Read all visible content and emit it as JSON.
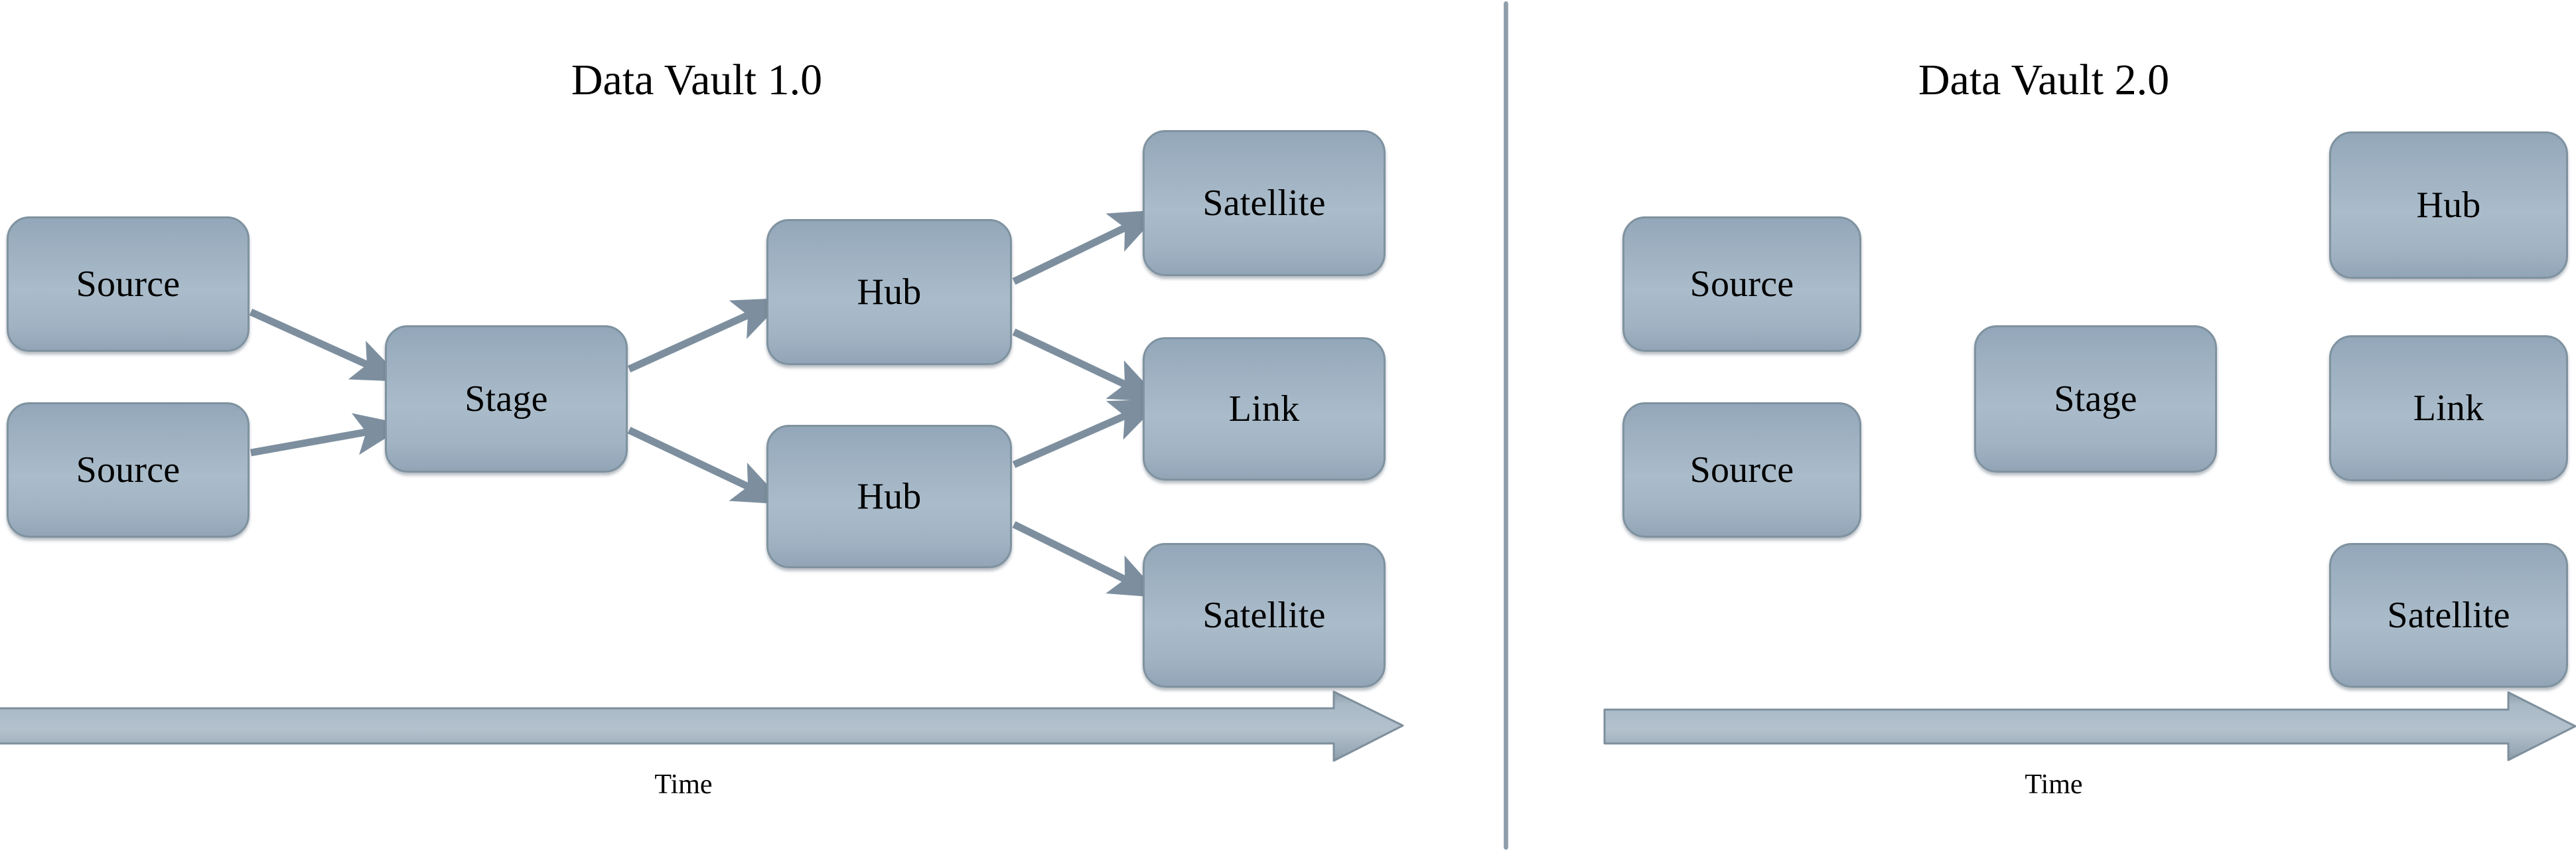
{
  "diagram": {
    "title_left": "Data Vault 1.0",
    "title_right": "Data Vault 2.0",
    "time_label_left": "Time",
    "time_label_right": "Time",
    "colors": {
      "node_fill_top": "#93a7ba",
      "node_fill_mid": "#aabcca",
      "node_border": "#7f929f",
      "connector": "#7d8f9f",
      "divider": "#8b99a7",
      "text": "#000000",
      "background": "#ffffff"
    }
  },
  "left_panel": {
    "title": "Data Vault 1.0",
    "nodes": [
      {
        "id": "l-source-1",
        "label": "Source"
      },
      {
        "id": "l-source-2",
        "label": "Source"
      },
      {
        "id": "l-stage",
        "label": "Stage"
      },
      {
        "id": "l-hub-1",
        "label": "Hub"
      },
      {
        "id": "l-hub-2",
        "label": "Hub"
      },
      {
        "id": "l-satellite-1",
        "label": "Satellite"
      },
      {
        "id": "l-link",
        "label": "Link"
      },
      {
        "id": "l-satellite-2",
        "label": "Satellite"
      }
    ],
    "edges": [
      {
        "from": "l-source-1",
        "to": "l-stage"
      },
      {
        "from": "l-source-2",
        "to": "l-stage"
      },
      {
        "from": "l-stage",
        "to": "l-hub-1"
      },
      {
        "from": "l-stage",
        "to": "l-hub-2"
      },
      {
        "from": "l-hub-1",
        "to": "l-satellite-1"
      },
      {
        "from": "l-hub-1",
        "to": "l-link"
      },
      {
        "from": "l-hub-2",
        "to": "l-link"
      },
      {
        "from": "l-hub-2",
        "to": "l-satellite-2"
      }
    ],
    "time_label": "Time"
  },
  "right_panel": {
    "title": "Data Vault 2.0",
    "nodes": [
      {
        "id": "r-source-1",
        "label": "Source"
      },
      {
        "id": "r-source-2",
        "label": "Source"
      },
      {
        "id": "r-stage",
        "label": "Stage"
      },
      {
        "id": "r-hub",
        "label": "Hub"
      },
      {
        "id": "r-link",
        "label": "Link"
      },
      {
        "id": "r-satellite",
        "label": "Satellite"
      }
    ],
    "edges": [
      {
        "from": "r-source-1",
        "to": "r-stage"
      },
      {
        "from": "r-source-2",
        "to": "r-stage"
      },
      {
        "from": "r-stage",
        "to": "r-hub"
      },
      {
        "from": "r-stage",
        "to": "r-link"
      },
      {
        "from": "r-stage",
        "to": "r-satellite"
      }
    ],
    "time_label": "Time"
  }
}
